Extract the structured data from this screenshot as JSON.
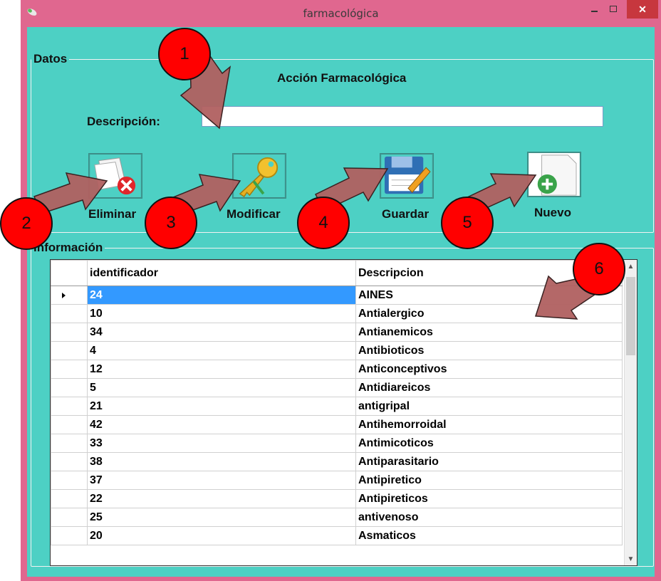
{
  "window": {
    "title": "farmacológica"
  },
  "datos": {
    "legend": "Datos",
    "heading": "Acción Farmacológica",
    "description_label": "Descripción:",
    "description_value": ""
  },
  "toolbar": {
    "delete_label": "Eliminar",
    "modify_label": "Modificar",
    "save_label": "Guardar",
    "new_label": "Nuevo"
  },
  "info": {
    "legend": "Información",
    "columns": [
      "identificador",
      "Descripcion"
    ],
    "rows": [
      [
        "24",
        "AINES"
      ],
      [
        "10",
        "Antialergico"
      ],
      [
        "34",
        "Antianemicos"
      ],
      [
        "4",
        "Antibioticos"
      ],
      [
        "12",
        "Anticonceptivos"
      ],
      [
        "5",
        "Antidiareicos"
      ],
      [
        "21",
        "antigripal"
      ],
      [
        "42",
        "Antihemorroidal"
      ],
      [
        "33",
        "Antimicoticos"
      ],
      [
        "38",
        "Antiparasitario"
      ],
      [
        "37",
        "Antipiretico"
      ],
      [
        "22",
        "Antipireticos"
      ],
      [
        "25",
        "antivenoso"
      ],
      [
        "20",
        "Asmaticos"
      ]
    ],
    "selected_row": 0
  },
  "callouts": [
    "1",
    "2",
    "3",
    "4",
    "5",
    "6"
  ],
  "colors": {
    "window_frame": "#e0678f",
    "client": "#4dd0c4",
    "callout": "#ff0000",
    "arrow": "#b06060",
    "selection": "#3399ff",
    "close": "#c7373e"
  }
}
